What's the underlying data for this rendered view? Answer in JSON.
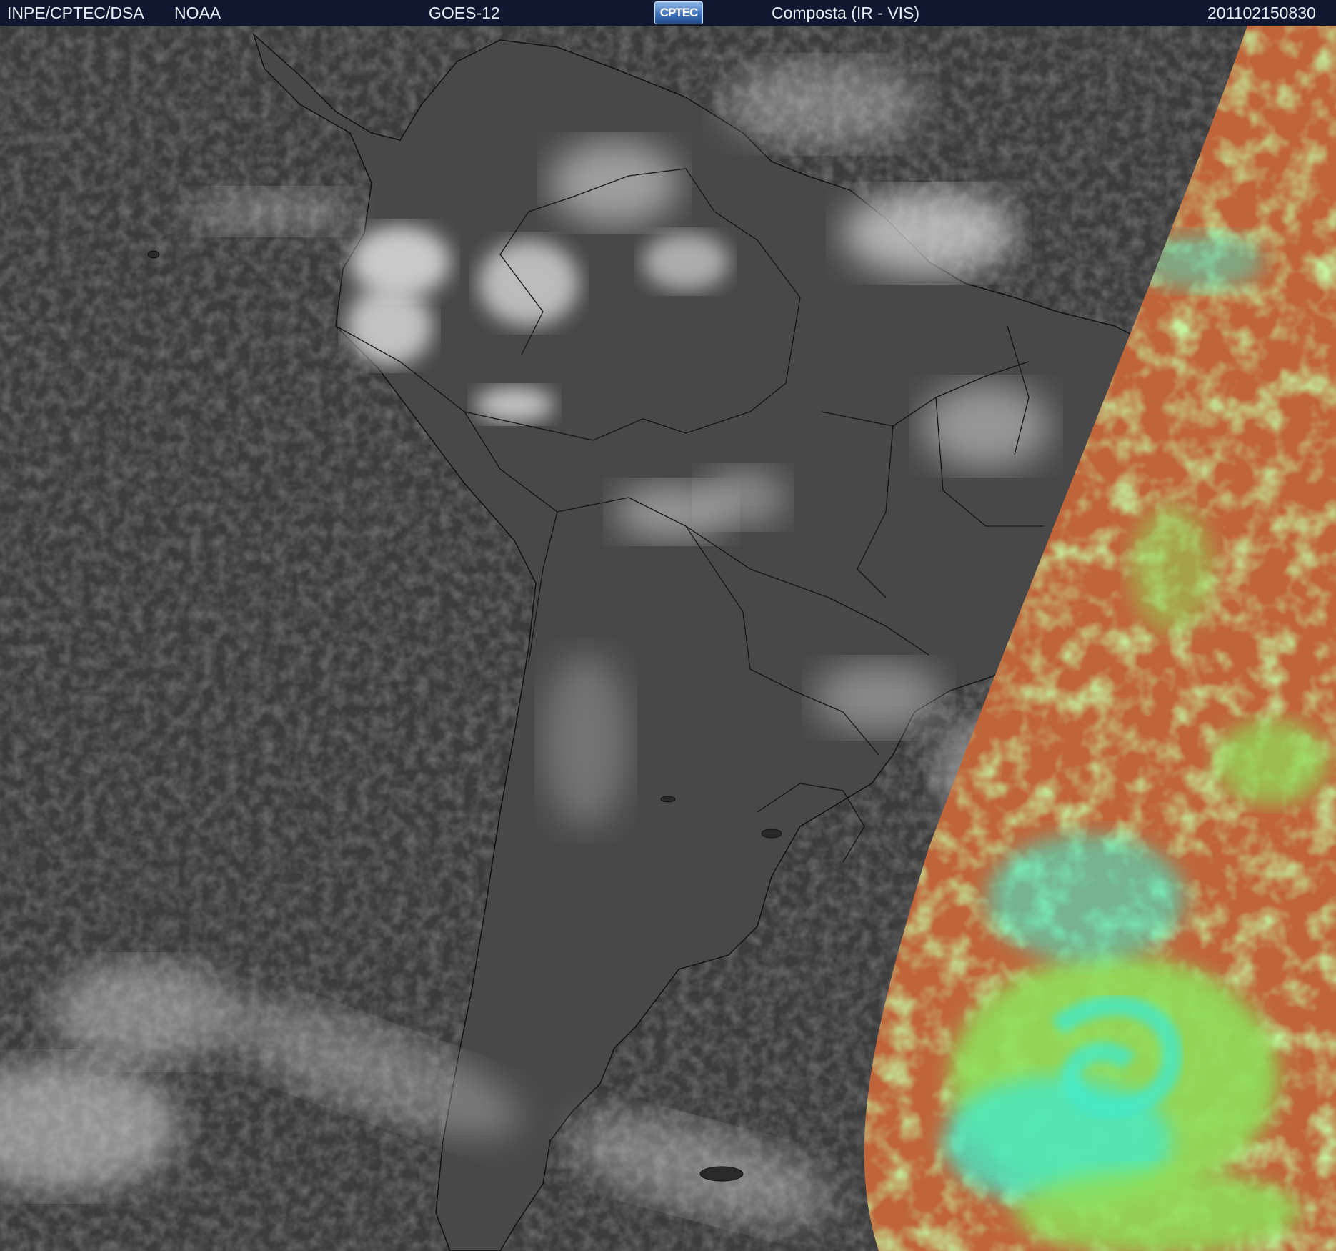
{
  "header": {
    "agency": "INPE/CPTEC/DSA",
    "source": "NOAA",
    "satellite": "GOES-12",
    "logo_text": "CPTEC",
    "product": "Composta (IR - VIS)",
    "timestamp": "201102150830"
  },
  "colors": {
    "header_bg": "#0f1830",
    "ocean_gray": "#3b3b3b",
    "land_gray": "#4a4a4a",
    "cloud_white": "#dcdcdc",
    "ir_orange": "#c0653a",
    "ir_green": "#8ee05a",
    "ir_cyan": "#44e8c8"
  }
}
